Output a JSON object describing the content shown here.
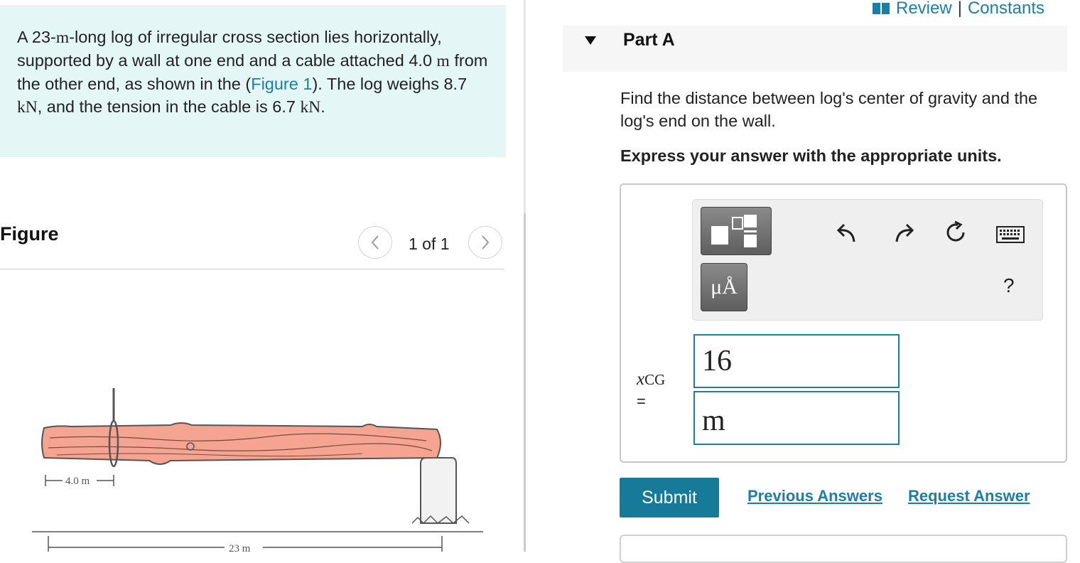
{
  "problem": {
    "text_1": "A 23-",
    "text_m1": "m",
    "text_2": "-long log of irregular cross section lies horizontally, supported by a wall at one end and a cable attached 4.0 ",
    "text_m2": "m",
    "text_3": " from the other end, as shown in the (",
    "figure_link": "Figure 1",
    "text_4": "). The log weighs 8.7 ",
    "text_kn1": "kN",
    "text_5": ", and the tension in the cable is 6.7 ",
    "text_kn2": "kN",
    "text_6": "."
  },
  "figure": {
    "title": "Figure",
    "counter": "1 of 1",
    "prev_icon": "chevron-left-icon",
    "next_icon": "chevron-right-icon",
    "label_4m": "4.0 m",
    "label_23m": "23 m"
  },
  "header": {
    "review_icon": "book-icon",
    "review_link": "Review",
    "separator": "|",
    "constants_link": "Constants"
  },
  "part": {
    "title": "Part A",
    "question": "Find the distance between log's center of gravity and the log's end on the wall.",
    "instruction": "Express your answer with the appropriate units."
  },
  "toolbar": {
    "templates_icon": "fraction-template-icon",
    "units_button": "μÅ",
    "undo_icon": "undo-icon",
    "redo_icon": "redo-icon",
    "reset_icon": "reset-icon",
    "keyboard_icon": "keyboard-icon",
    "help_button": "?"
  },
  "answer": {
    "variable": "x",
    "subscript": "CG",
    "equals": "=",
    "value": "16",
    "unit": "m"
  },
  "actions": {
    "submit": "Submit",
    "previous_answers": "Previous Answers",
    "request_answer": "Request Answer"
  }
}
